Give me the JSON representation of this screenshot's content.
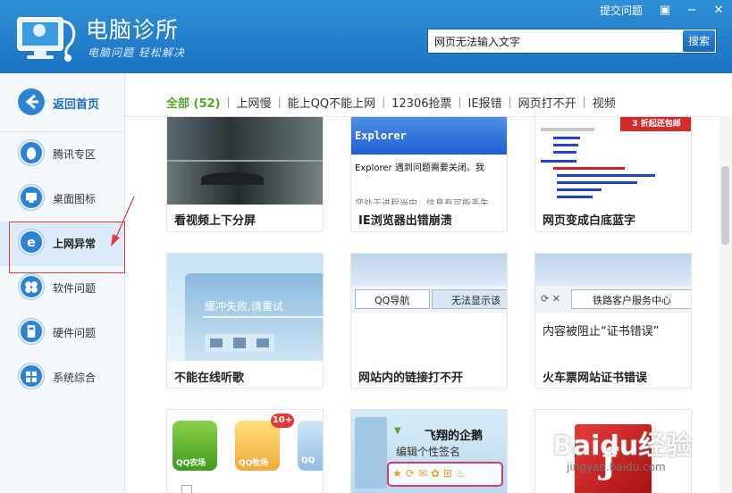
{
  "app": {
    "title": "电脑诊所",
    "slogan": "电脑问题 轻松解决"
  },
  "top_links": {
    "feedback": "提交问题",
    "menu_glyph": "▣",
    "minimize_glyph": "−",
    "close_glyph": "✕"
  },
  "search": {
    "value": "网页无法输入文字",
    "button": "搜索"
  },
  "sidebar": {
    "back": "返回首页",
    "items": [
      {
        "label": "腾讯专区",
        "icon": "qq-penguin-icon"
      },
      {
        "label": "桌面图标",
        "icon": "desktop-icon"
      },
      {
        "label": "上网异常",
        "icon": "ie-icon",
        "active": true
      },
      {
        "label": "软件问题",
        "icon": "software-icon"
      },
      {
        "label": "硬件问题",
        "icon": "hardware-icon"
      },
      {
        "label": "系统综合",
        "icon": "windows-icon"
      }
    ]
  },
  "filters": [
    "全部 (52)",
    "上网慢",
    "能上QQ不能上网",
    "12306抢票",
    "IE报错",
    "网页打不开",
    "视频"
  ],
  "cards": [
    {
      "title": "看视频上下分屏"
    },
    {
      "title": "IE浏览器出错崩溃",
      "img_head": "Explorer",
      "img_text": "Explorer 遇到问题需要关闭。我",
      "img_text2": "您处于进程当中，信息有可能丢失"
    },
    {
      "title": "网页变成白底蓝字",
      "img_banner": "3 折起还包邮"
    },
    {
      "title": "不能在线听歌",
      "img_text": "缓冲失败,请重试"
    },
    {
      "title": "网站内的链接打不开",
      "img_tab1": "QQ导航",
      "img_tab2": "无法显示该"
    },
    {
      "title": "火车票网站证书错误",
      "img_tab": "铁路客户服务中心",
      "img_text": "内容被阻止“证书错误”"
    },
    {
      "title": "",
      "img_labels": [
        "QQ农场",
        "QQ牧场",
        "QQ"
      ],
      "img_badge": "10+"
    },
    {
      "title": "",
      "img_name": "飞翔的企鹅",
      "img_sign": "编辑个性签名"
    },
    {
      "title": ""
    }
  ],
  "watermark": {
    "brand": "Baidu经验",
    "url": "jingyan.baidu.com"
  },
  "colors": {
    "header": "#1a72c2",
    "accent": "#2c82d3",
    "filter_active": "#4caa22",
    "annotation": "#e53935"
  }
}
